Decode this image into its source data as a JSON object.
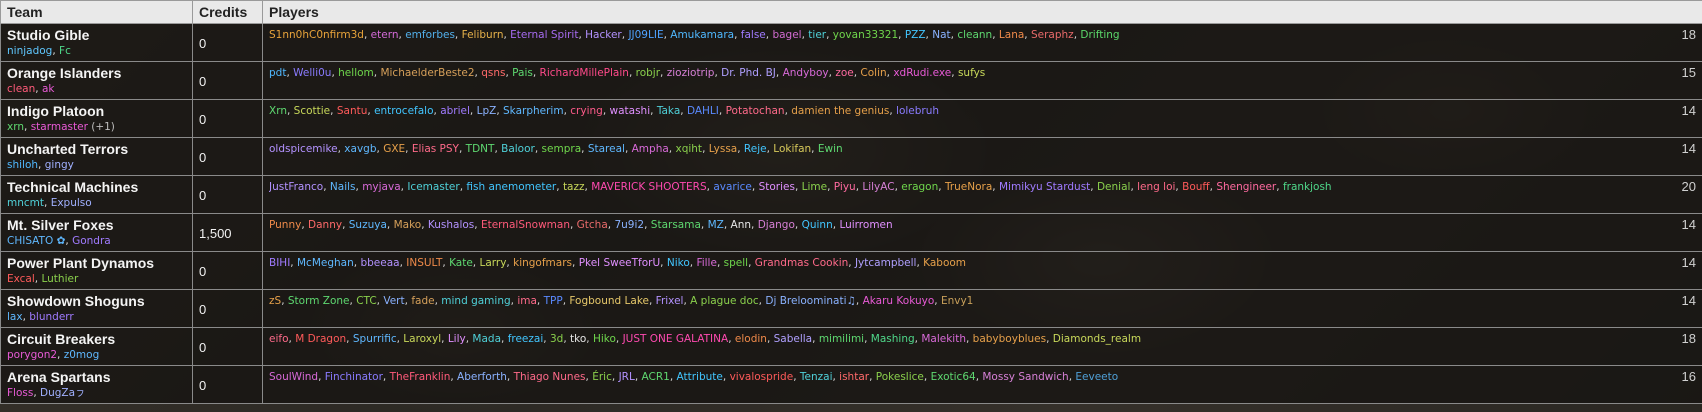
{
  "headers": {
    "team": "Team",
    "credits": "Credits",
    "players": "Players"
  },
  "teams": [
    {
      "name": "Studio Gible",
      "managers": [
        {
          "name": "ninjadog",
          "color": "#5fc8ff"
        },
        {
          "name": "Fc",
          "color": "#4fd88a"
        }
      ],
      "extra": "",
      "credits": "0",
      "count": "18",
      "players": [
        {
          "name": "S1nn0hC0nfirm3d",
          "color": "#e8a33a"
        },
        {
          "name": "etern",
          "color": "#d36ad8"
        },
        {
          "name": "emforbes",
          "color": "#52b0ec"
        },
        {
          "name": "Feliburn",
          "color": "#e6b14a"
        },
        {
          "name": "Eternal Spirit",
          "color": "#a66bf0"
        },
        {
          "name": "Hacker",
          "color": "#b392ff"
        },
        {
          "name": "JJ09LIE",
          "color": "#4ea2ff"
        },
        {
          "name": "Amukamara",
          "color": "#4fb8ff"
        },
        {
          "name": "false",
          "color": "#a07bff"
        },
        {
          "name": "bagel",
          "color": "#d26bd2"
        },
        {
          "name": "tier",
          "color": "#4fd0d8"
        },
        {
          "name": "yovan33321",
          "color": "#6fd64c"
        },
        {
          "name": "PZZ",
          "color": "#42c6ff"
        },
        {
          "name": "Nat",
          "color": "#8ab2ff"
        },
        {
          "name": "cleann",
          "color": "#5ed870"
        },
        {
          "name": "Lana",
          "color": "#ef8a4a"
        },
        {
          "name": "Seraphz",
          "color": "#e86a6a"
        },
        {
          "name": "Drifting",
          "color": "#5bd86b"
        }
      ]
    },
    {
      "name": "Orange Islanders",
      "managers": [
        {
          "name": "clean",
          "color": "#ff5a7a"
        },
        {
          "name": "ak",
          "color": "#e85ad6"
        }
      ],
      "extra": "",
      "credits": "0",
      "count": "15",
      "players": [
        {
          "name": "pdt",
          "color": "#4fb8ff"
        },
        {
          "name": "Welli0u",
          "color": "#8a7bff"
        },
        {
          "name": "hellom",
          "color": "#6fd64c"
        },
        {
          "name": "MichaelderBeste2",
          "color": "#d6a05a"
        },
        {
          "name": "qsns",
          "color": "#ff6a6a"
        },
        {
          "name": "Pais",
          "color": "#5ed870"
        },
        {
          "name": "RichardMillePlain",
          "color": "#ff4a8a"
        },
        {
          "name": "robjr",
          "color": "#8ad04c"
        },
        {
          "name": "zioziotrip",
          "color": "#d680d6"
        },
        {
          "name": "Dr. Phd. BJ",
          "color": "#b0a0ff"
        },
        {
          "name": "Andyboy",
          "color": "#d86ad8"
        },
        {
          "name": "zoe",
          "color": "#ff6aa0"
        },
        {
          "name": "Colin",
          "color": "#e6a04a"
        },
        {
          "name": "xdRudi.exe",
          "color": "#e85ad6"
        },
        {
          "name": "sufys",
          "color": "#c8d85a"
        }
      ]
    },
    {
      "name": "Indigo Platoon",
      "managers": [
        {
          "name": "xrn",
          "color": "#5ed870"
        },
        {
          "name": "starmaster",
          "color": "#e85ad6"
        }
      ],
      "extra": "(+1)",
      "credits": "0",
      "count": "14",
      "players": [
        {
          "name": "Xrn",
          "color": "#5ed870"
        },
        {
          "name": "Scottie",
          "color": "#c8d85a"
        },
        {
          "name": "Santu",
          "color": "#ff5a5a"
        },
        {
          "name": "entrocefalo",
          "color": "#42c6ff"
        },
        {
          "name": "abriel",
          "color": "#a07bff"
        },
        {
          "name": "LpZ",
          "color": "#8ab2ff"
        },
        {
          "name": "Skarpherim",
          "color": "#5fb8ff"
        },
        {
          "name": "crying",
          "color": "#ff5a8a"
        },
        {
          "name": "watashi",
          "color": "#e090ff"
        },
        {
          "name": "Taka",
          "color": "#4fd0d8"
        },
        {
          "name": "DAHLI",
          "color": "#5a8aff"
        },
        {
          "name": "Potatochan",
          "color": "#ff6a8a"
        },
        {
          "name": "damien the genius",
          "color": "#e6a04a"
        },
        {
          "name": "lolebruh",
          "color": "#8a7bff"
        }
      ]
    },
    {
      "name": "Uncharted Terrors",
      "managers": [
        {
          "name": "shiloh",
          "color": "#4fb8ff"
        },
        {
          "name": "gingy",
          "color": "#a0b0ff"
        }
      ],
      "extra": "",
      "credits": "0",
      "count": "14",
      "players": [
        {
          "name": "oldspicemike",
          "color": "#b392ff"
        },
        {
          "name": "xavgb",
          "color": "#5fb8ff"
        },
        {
          "name": "GXE",
          "color": "#e6a04a"
        },
        {
          "name": "Elias PSY",
          "color": "#ff6a8a"
        },
        {
          "name": "TDNT",
          "color": "#5ed870"
        },
        {
          "name": "Baloor",
          "color": "#4fd0d8"
        },
        {
          "name": "sempra",
          "color": "#6fd64c"
        },
        {
          "name": "Stareal",
          "color": "#5fb8ff"
        },
        {
          "name": "Ampha",
          "color": "#d86ad8"
        },
        {
          "name": "xqiht",
          "color": "#8ad04c"
        },
        {
          "name": "Lyssa",
          "color": "#e6a04a"
        },
        {
          "name": "Reje",
          "color": "#42c6ff"
        },
        {
          "name": "Lokifan",
          "color": "#d6c85a"
        },
        {
          "name": "Ewin",
          "color": "#5ed870"
        }
      ]
    },
    {
      "name": "Technical Machines",
      "managers": [
        {
          "name": "mncmt",
          "color": "#4fd0d8"
        },
        {
          "name": "Expulso",
          "color": "#a0b0ff"
        }
      ],
      "extra": "",
      "credits": "0",
      "count": "20",
      "players": [
        {
          "name": "JustFranco",
          "color": "#b392ff"
        },
        {
          "name": "Nails",
          "color": "#5fb8ff"
        },
        {
          "name": "myjava",
          "color": "#d86ad8"
        },
        {
          "name": "Icemaster",
          "color": "#4fd0d8"
        },
        {
          "name": "fish anemometer",
          "color": "#42c6ff"
        },
        {
          "name": "tazz",
          "color": "#c8d85a"
        },
        {
          "name": "MAVERICK SHOOTERS",
          "color": "#ff4ab0"
        },
        {
          "name": "avarice",
          "color": "#5a8aff"
        },
        {
          "name": "Stories",
          "color": "#e090ff"
        },
        {
          "name": "Lime",
          "color": "#8ad04c"
        },
        {
          "name": "Piyu",
          "color": "#ff6aa0"
        },
        {
          "name": "LilyAC",
          "color": "#d680d6"
        },
        {
          "name": "eragon",
          "color": "#6fd64c"
        },
        {
          "name": "TrueNora",
          "color": "#e6a04a"
        },
        {
          "name": "Mimikyu Stardust",
          "color": "#a07bff"
        },
        {
          "name": "Denial",
          "color": "#8ad04c"
        },
        {
          "name": "leng loi",
          "color": "#ff6a8a"
        },
        {
          "name": "Bouff",
          "color": "#ff5a5a"
        },
        {
          "name": "Shengineer",
          "color": "#ff6aa0"
        },
        {
          "name": "frankjosh",
          "color": "#4fd88a"
        }
      ]
    },
    {
      "name": "Mt. Silver Foxes",
      "managers": [
        {
          "name": "CHISATO ✿",
          "color": "#5fb8ff"
        },
        {
          "name": "Gondra",
          "color": "#a07bff"
        }
      ],
      "extra": "",
      "credits": "1,500",
      "count": "14",
      "players": [
        {
          "name": "Punny",
          "color": "#ef8a4a"
        },
        {
          "name": "Danny",
          "color": "#ff6a6a"
        },
        {
          "name": "Suzuya",
          "color": "#5fb8ff"
        },
        {
          "name": "Mako",
          "color": "#d6a05a"
        },
        {
          "name": "Kushalos",
          "color": "#b392ff"
        },
        {
          "name": "EternalSnowman",
          "color": "#ff5a7a"
        },
        {
          "name": "Gtcha",
          "color": "#e86a6a"
        },
        {
          "name": "7u9i2",
          "color": "#8ab2ff"
        },
        {
          "name": "Starsama",
          "color": "#5ed870"
        },
        {
          "name": "MZ",
          "color": "#5fb8ff"
        },
        {
          "name": "Ann",
          "color": "#e6e6e6"
        },
        {
          "name": "Django",
          "color": "#d680d6"
        },
        {
          "name": "Quinn",
          "color": "#42c6ff"
        },
        {
          "name": "Luirromen",
          "color": "#e090ff"
        }
      ]
    },
    {
      "name": "Power Plant Dynamos",
      "managers": [
        {
          "name": "Excal",
          "color": "#ff5a5a"
        },
        {
          "name": "Luthier",
          "color": "#8ad04c"
        }
      ],
      "extra": "",
      "credits": "0",
      "count": "14",
      "players": [
        {
          "name": "BIHI",
          "color": "#a07bff"
        },
        {
          "name": "McMeghan",
          "color": "#5fb8ff"
        },
        {
          "name": "bbeeaa",
          "color": "#b392ff"
        },
        {
          "name": "INSULT",
          "color": "#ef8a4a"
        },
        {
          "name": "Kate",
          "color": "#5ed870"
        },
        {
          "name": "Larry",
          "color": "#c8d85a"
        },
        {
          "name": "kingofmars",
          "color": "#e6a04a"
        },
        {
          "name": "Pkel SweeTforU",
          "color": "#e090ff"
        },
        {
          "name": "Niko",
          "color": "#42c6ff"
        },
        {
          "name": "Fille",
          "color": "#d86ad8"
        },
        {
          "name": "spell",
          "color": "#6fd64c"
        },
        {
          "name": "Grandmas Cookin",
          "color": "#ff6a8a"
        },
        {
          "name": "Jytcampbell",
          "color": "#b0a0ff"
        },
        {
          "name": "Kaboom",
          "color": "#e6a04a"
        }
      ]
    },
    {
      "name": "Showdown Shoguns",
      "managers": [
        {
          "name": "lax",
          "color": "#5fb8ff"
        },
        {
          "name": "blunderr",
          "color": "#a07bff"
        }
      ],
      "extra": "",
      "credits": "0",
      "count": "14",
      "players": [
        {
          "name": "zS",
          "color": "#e6a04a"
        },
        {
          "name": "Storm Zone",
          "color": "#5ed870"
        },
        {
          "name": "CTC",
          "color": "#8ad04c"
        },
        {
          "name": "Vert",
          "color": "#8ab2ff"
        },
        {
          "name": "fade",
          "color": "#d6a05a"
        },
        {
          "name": "mind gaming",
          "color": "#4fd0d8"
        },
        {
          "name": "ima",
          "color": "#ff6a8a"
        },
        {
          "name": "TPP",
          "color": "#5a8aff"
        },
        {
          "name": "Fogbound Lake",
          "color": "#e6c86a"
        },
        {
          "name": "Frixel",
          "color": "#b392ff"
        },
        {
          "name": "A plague doc",
          "color": "#8ad04c"
        },
        {
          "name": "Dj Breloominati♫",
          "color": "#8ab2ff"
        },
        {
          "name": "Akaru Kokuyo",
          "color": "#e85ad6"
        },
        {
          "name": "Envy1",
          "color": "#c8a05a"
        }
      ]
    },
    {
      "name": "Circuit Breakers",
      "managers": [
        {
          "name": "porygon2",
          "color": "#e85ad6"
        },
        {
          "name": "z0mog",
          "color": "#5fb8ff"
        }
      ],
      "extra": "",
      "credits": "0",
      "count": "18",
      "players": [
        {
          "name": "eifo",
          "color": "#ff6a8a"
        },
        {
          "name": "M Dragon",
          "color": "#ff5a5a"
        },
        {
          "name": "Spurrific",
          "color": "#5fb8ff"
        },
        {
          "name": "Laroxyl",
          "color": "#c8d85a"
        },
        {
          "name": "Lily",
          "color": "#e090ff"
        },
        {
          "name": "Mada",
          "color": "#4fd0d8"
        },
        {
          "name": "freezai",
          "color": "#42c6ff"
        },
        {
          "name": "3d",
          "color": "#8ad04c"
        },
        {
          "name": "tko",
          "color": "#e6e6e6"
        },
        {
          "name": "Hiko",
          "color": "#6fd64c"
        },
        {
          "name": "JUST ONE GALATINA",
          "color": "#ff4ab0"
        },
        {
          "name": "elodin",
          "color": "#ef8a4a"
        },
        {
          "name": "Sabella",
          "color": "#b0a0ff"
        },
        {
          "name": "mimilimi",
          "color": "#5ed870"
        },
        {
          "name": "Mashing",
          "color": "#4fd88a"
        },
        {
          "name": "Malekith",
          "color": "#d86ad8"
        },
        {
          "name": "babyboyblues",
          "color": "#e6a04a"
        },
        {
          "name": "Diamonds_realm",
          "color": "#c8d85a"
        }
      ]
    },
    {
      "name": "Arena Spartans",
      "managers": [
        {
          "name": "Floss",
          "color": "#e85ad6"
        },
        {
          "name": "DugZaㇷ",
          "color": "#a0b0ff"
        }
      ],
      "extra": "",
      "credits": "0",
      "count": "16",
      "players": [
        {
          "name": "SoulWind",
          "color": "#d86ad8"
        },
        {
          "name": "Finchinator",
          "color": "#8a7bff"
        },
        {
          "name": "TheFranklin",
          "color": "#ff5a7a"
        },
        {
          "name": "Aberforth",
          "color": "#8ab2ff"
        },
        {
          "name": "Thiago Nunes",
          "color": "#ff6a8a"
        },
        {
          "name": "Éric",
          "color": "#8ad04c"
        },
        {
          "name": "JRL",
          "color": "#b392ff"
        },
        {
          "name": "ACR1",
          "color": "#5ed870"
        },
        {
          "name": "Attribute",
          "color": "#42c6ff"
        },
        {
          "name": "vivalospride",
          "color": "#ff5a5a"
        },
        {
          "name": "Tenzai",
          "color": "#4fd0d8"
        },
        {
          "name": "ishtar",
          "color": "#ff6a6a"
        },
        {
          "name": "Pokeslice",
          "color": "#8ad04c"
        },
        {
          "name": "Exotic64",
          "color": "#5ed870"
        },
        {
          "name": "Mossy Sandwich",
          "color": "#d680d6"
        },
        {
          "name": "Eeveeto",
          "color": "#4fa0d8"
        }
      ]
    }
  ]
}
